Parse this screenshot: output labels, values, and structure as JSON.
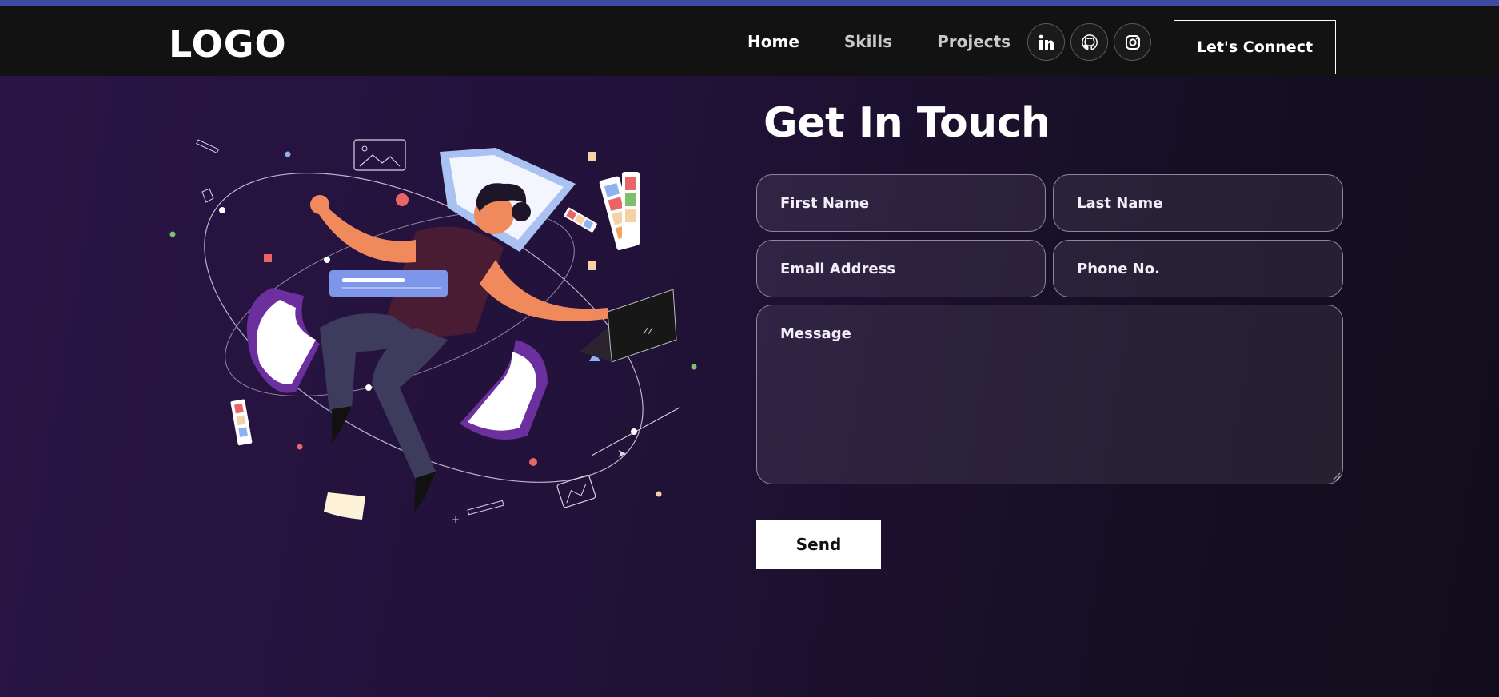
{
  "navbar": {
    "logo": "LOGO",
    "links": [
      "Home",
      "Skills",
      "Projects"
    ],
    "active_link": "Home",
    "social_icons": [
      "linkedin-icon",
      "github-icon",
      "instagram-icon"
    ],
    "cta_label": "Let's Connect"
  },
  "contact": {
    "title": "Get In Touch",
    "fields": {
      "first_name": "First Name",
      "last_name": "Last Name",
      "email": "Email Address",
      "phone": "Phone No.",
      "message": "Message"
    },
    "send_label": "Send"
  },
  "colors": {
    "accent_strip": "#3f4aa5",
    "navbar_bg": "#121212",
    "background_start": "#2a1446",
    "background_end": "#120d1c"
  }
}
